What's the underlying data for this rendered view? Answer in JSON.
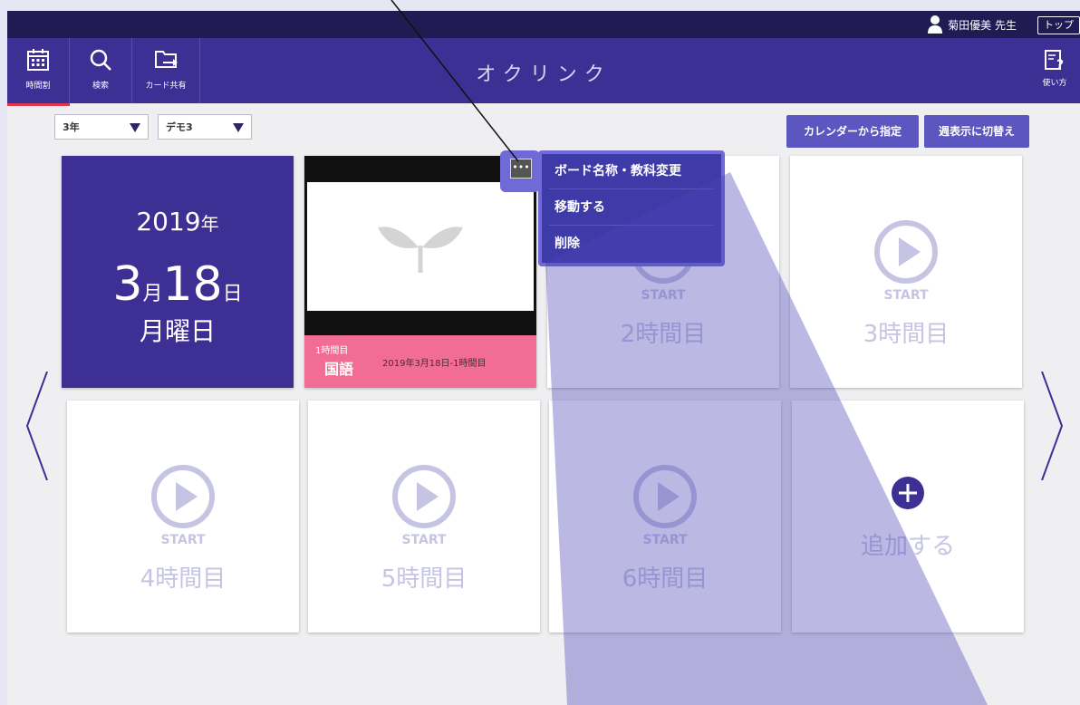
{
  "header": {
    "user_name": "菊田優美 先生",
    "top_button": "トップ",
    "app_title": "オクリンク",
    "nav": [
      {
        "label": "時間割",
        "icon": "calendar-icon"
      },
      {
        "label": "検索",
        "icon": "search-icon"
      },
      {
        "label": "カード共有",
        "icon": "folder-share-icon"
      }
    ],
    "help_label": "使い方"
  },
  "filters": {
    "grade": "3年",
    "class": "デモ3"
  },
  "actions": {
    "calendar_button": "カレンダーから指定",
    "week_view_button": "週表示に切替え"
  },
  "date_card": {
    "year": "2019",
    "year_unit": "年",
    "month": "3",
    "month_unit": "月",
    "day": "18",
    "day_unit": "日",
    "weekday": "月曜日"
  },
  "board_card": {
    "more_icon": "•••",
    "period": "1時間目",
    "subject": "国語",
    "board_name": "2019年3月18日-1時間目"
  },
  "period_cards": [
    {
      "start": "START",
      "label": "2時間目"
    },
    {
      "start": "START",
      "label": "3時間目"
    },
    {
      "start": "START",
      "label": "4時間目"
    },
    {
      "start": "START",
      "label": "5時間目"
    },
    {
      "start": "START",
      "label": "6時間目"
    }
  ],
  "add_card": {
    "label": "追加する"
  },
  "context_menu": {
    "items": [
      "ボード名称・教科変更",
      "移動する",
      "削除"
    ]
  },
  "colors": {
    "topbar": "#201b52",
    "navbar": "#3e2f95",
    "board_info": "#f26d95",
    "menu": "#3e3aa7",
    "accent_button": "#5b56c0"
  }
}
